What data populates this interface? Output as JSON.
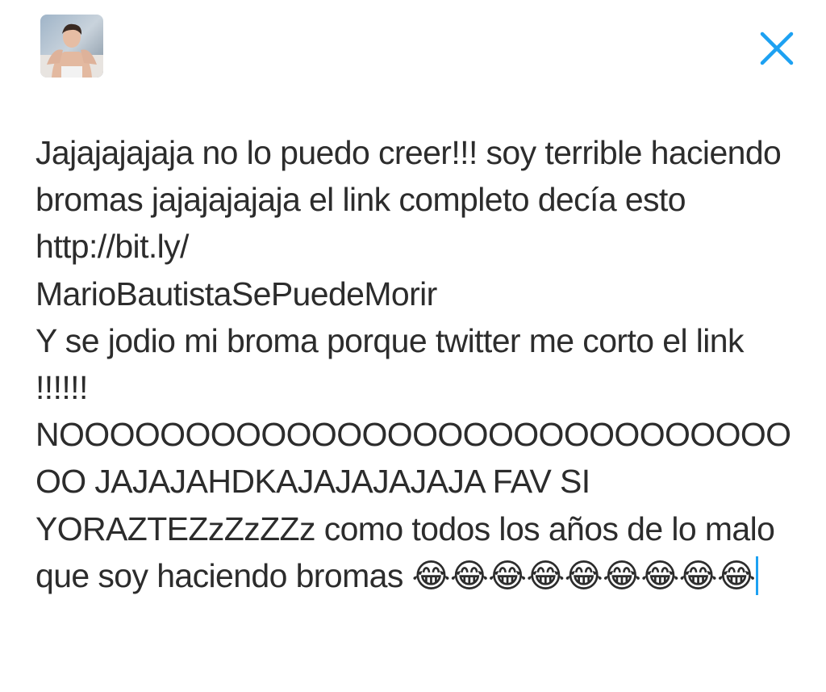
{
  "header": {
    "avatar_icon": "user-avatar-photo",
    "close_icon": "close-x-icon",
    "accent_color": "#1da1f2"
  },
  "compose": {
    "text": "Jajajajajaja no lo puedo creer!!! soy terrible haciendo bromas jajajajajaja el link completo decía esto http://bit.ly/\nMarioBautistaSePuedeMorir\nY se jodio mi broma porque twitter me corto el link !!!!!! NOOOOOOOOOOOOOOOOOOOOOOOOOOOOOOO JAJAJAHDKAJAJAJAJAJA FAV SI YORAZTEZzZzZZz como todos los años de lo malo que soy haciendo bromas 😂😂😂😂😂😂😂😂😂"
  }
}
